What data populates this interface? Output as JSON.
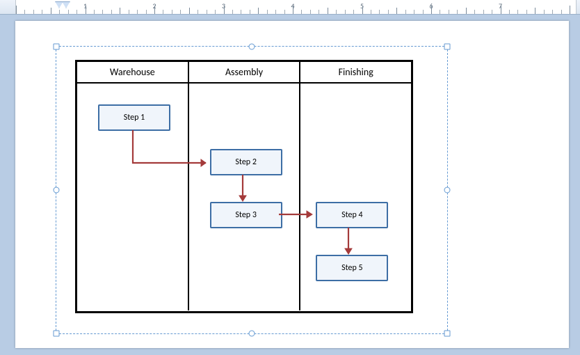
{
  "ruler": {
    "numbers": [
      "1",
      "2",
      "3",
      "4",
      "5",
      "6",
      "7"
    ]
  },
  "lanes": {
    "headers": [
      "Warehouse",
      "Assembly",
      "Finishing"
    ],
    "steps": {
      "s1": "Step 1",
      "s2": "Step 2",
      "s3": "Step 3",
      "s4": "Step 4",
      "s5": "Step 5"
    }
  }
}
